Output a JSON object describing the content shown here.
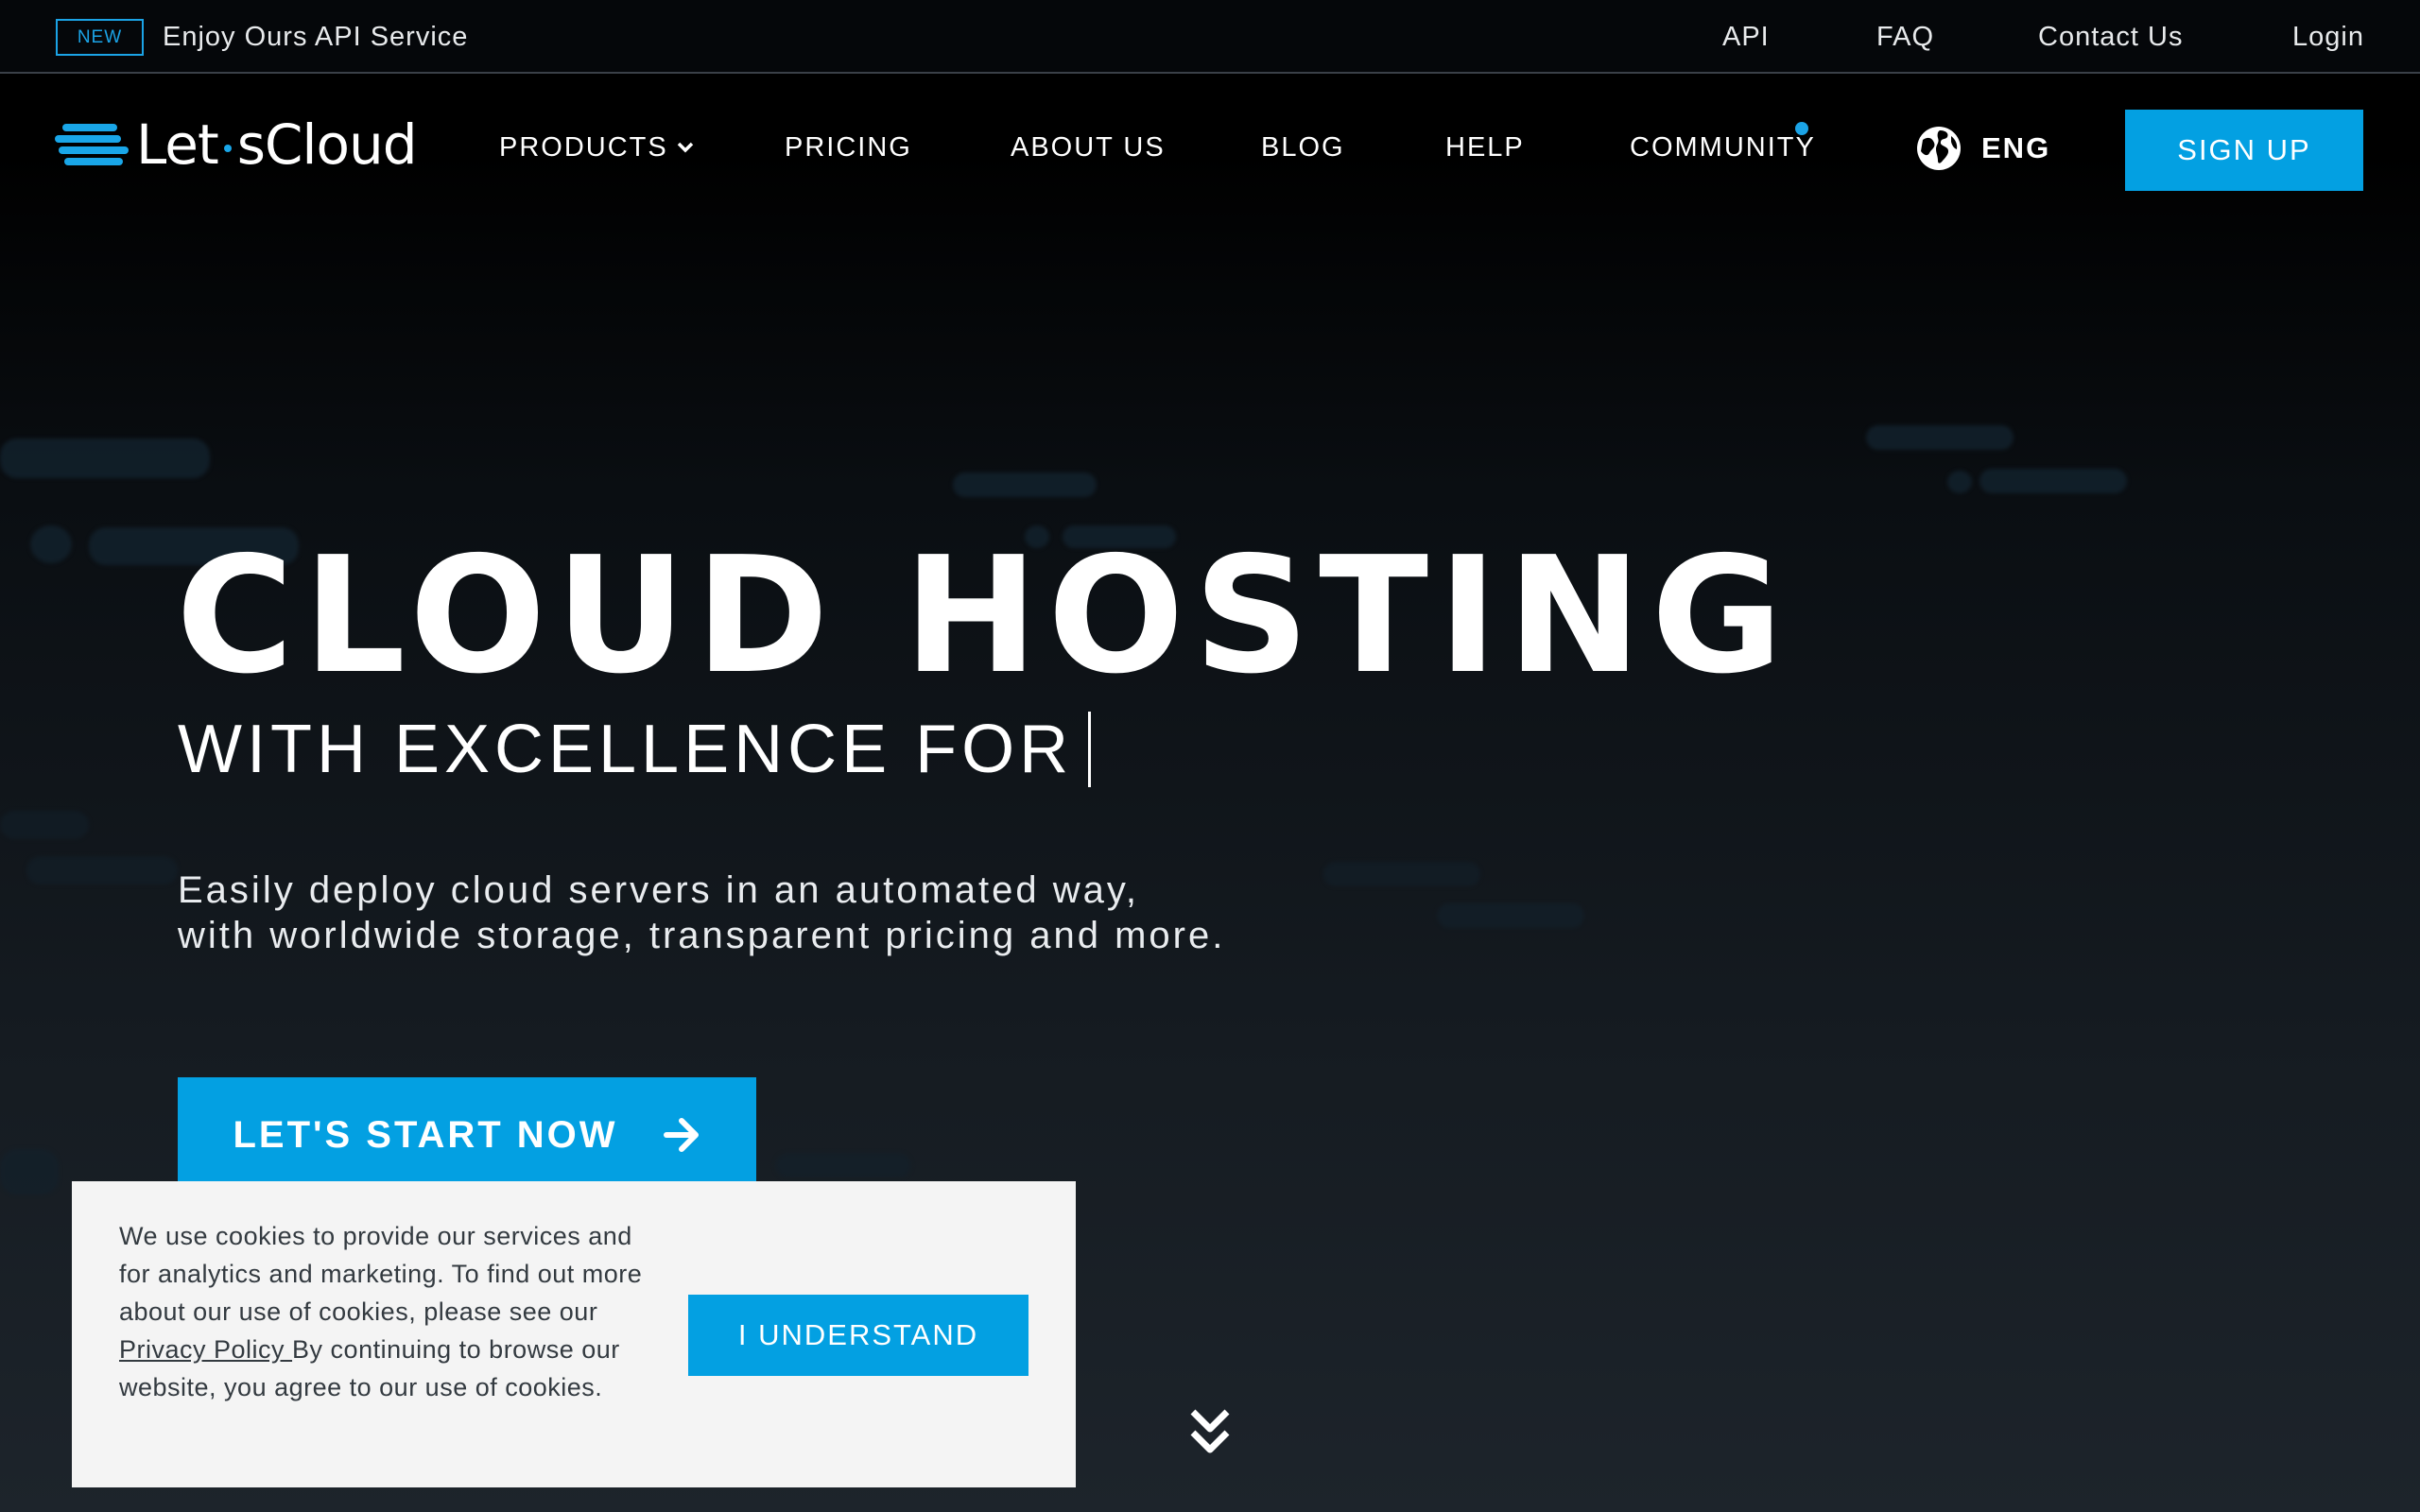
{
  "topbar": {
    "badge": "NEW",
    "announcement": "Enjoy Ours API Service",
    "links": [
      "API",
      "FAQ",
      "Contact Us",
      "Login"
    ]
  },
  "nav": {
    "logo_text_a": "Let",
    "logo_text_b": "sCloud",
    "items": [
      "PRODUCTS",
      "PRICING",
      "ABOUT US",
      "BLOG",
      "HELP",
      "COMMUNITY"
    ],
    "language": "ENG",
    "signup": "SIGN UP"
  },
  "hero": {
    "title": "CLOUD HOSTING",
    "subtitle": "WITH EXCELLENCE FOR",
    "description_line1": "Easily deploy cloud servers in an automated way,",
    "description_line2": "with worldwide storage, transparent pricing and more.",
    "cta": "LET'S START NOW"
  },
  "cookie": {
    "text_before": "We use cookies to provide our services and for analytics and marketing. To find out more about our use of cookies, please see our ",
    "link": "Privacy Policy ",
    "text_after": "By continuing to browse our website, you agree to our use of cookies.",
    "button": "I UNDERSTAND"
  },
  "colors": {
    "accent": "#03a0e2",
    "background": "#000000",
    "cookie_bg": "#f4f4f4"
  },
  "icons": [
    "chevron-down-icon",
    "globe-icon",
    "arrow-right-icon",
    "double-chevron-down-icon",
    "cloud-logo-icon"
  ]
}
